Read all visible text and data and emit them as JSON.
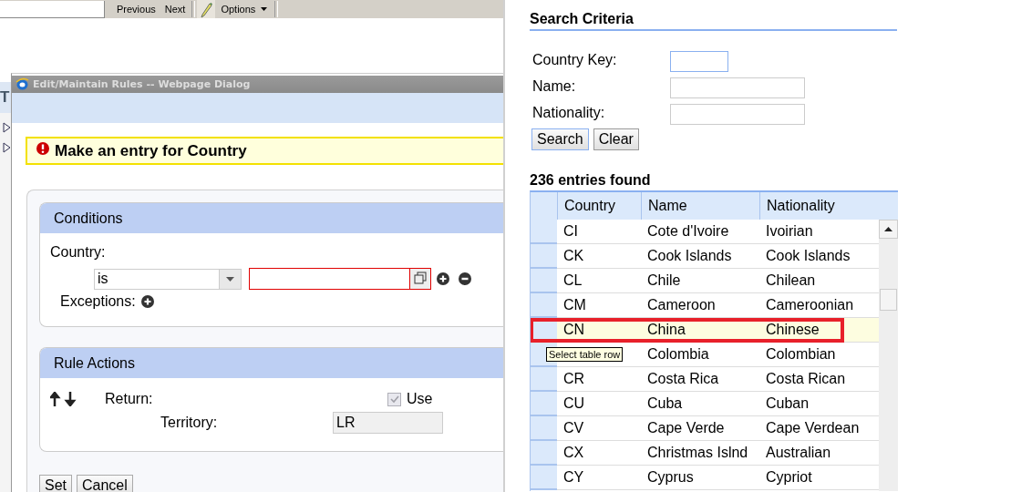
{
  "browser_toolbar": {
    "buttons": [
      {
        "label": "Previous"
      },
      {
        "label": "Next"
      }
    ],
    "options": {
      "label": "Options"
    }
  },
  "background_fragment": "T",
  "dialog": {
    "title": "Edit/Maintain Rules -- Webpage Dialog",
    "message": {
      "kind": "error",
      "text": "Make an entry for Country"
    },
    "conditions": {
      "title": "Conditions",
      "field_label": "Country:",
      "operator": "is",
      "value_invalid": true,
      "exceptions_label": "Exceptions:"
    },
    "rule_actions": {
      "title": "Rule Actions",
      "return_label": "Return:",
      "territory_label": "Territory:",
      "use": {
        "label": "Use",
        "checked": true,
        "disabled": true
      },
      "territory_value": "LR"
    },
    "buttons": [
      {
        "label": "Set"
      },
      {
        "label": "Cancel"
      }
    ]
  },
  "search": {
    "title": "Search Criteria",
    "fields": [
      {
        "label": "Country Key:",
        "focused": true
      },
      {
        "label": "Name:",
        "focused": false
      },
      {
        "label": "Nationality:",
        "focused": false
      }
    ],
    "buttons": [
      {
        "label": "Search",
        "focused": true
      },
      {
        "label": "Clear",
        "focused": false
      }
    ]
  },
  "results": {
    "count": "236 entries found",
    "columns": [
      "Country",
      "Name",
      "Nationality"
    ],
    "rows": [
      {
        "country": "CI",
        "name": "Cote d'Ivoire",
        "nationality": "Ivoirian",
        "selected": false,
        "highlighted": false
      },
      {
        "country": "CK",
        "name": "Cook Islands",
        "nationality": "Cook Islands",
        "selected": false,
        "highlighted": false
      },
      {
        "country": "CL",
        "name": "Chile",
        "nationality": "Chilean",
        "selected": false,
        "highlighted": false
      },
      {
        "country": "CM",
        "name": "Cameroon",
        "nationality": "Cameroonian",
        "selected": false,
        "highlighted": false
      },
      {
        "country": "CN",
        "name": "China",
        "nationality": "Chinese",
        "selected": true,
        "highlighted": true
      },
      {
        "name": "Colombia",
        "nationality": "Colombian",
        "selected": false,
        "highlighted": false,
        "tooltip": "Select table row"
      },
      {
        "country": "CR",
        "name": "Costa Rica",
        "nationality": "Costa Rican",
        "selected": false,
        "highlighted": false
      },
      {
        "country": "CU",
        "name": "Cuba",
        "nationality": "Cuban",
        "selected": false,
        "highlighted": false
      },
      {
        "country": "CV",
        "name": "Cape Verde",
        "nationality": "Cape Verdean",
        "selected": false,
        "highlighted": false
      },
      {
        "country": "CX",
        "name": "Christmas Islnd",
        "nationality": "Australian",
        "selected": false,
        "highlighted": false
      },
      {
        "country": "CY",
        "name": "Cyprus",
        "nationality": "Cypriot",
        "selected": false,
        "highlighted": false
      }
    ]
  }
}
